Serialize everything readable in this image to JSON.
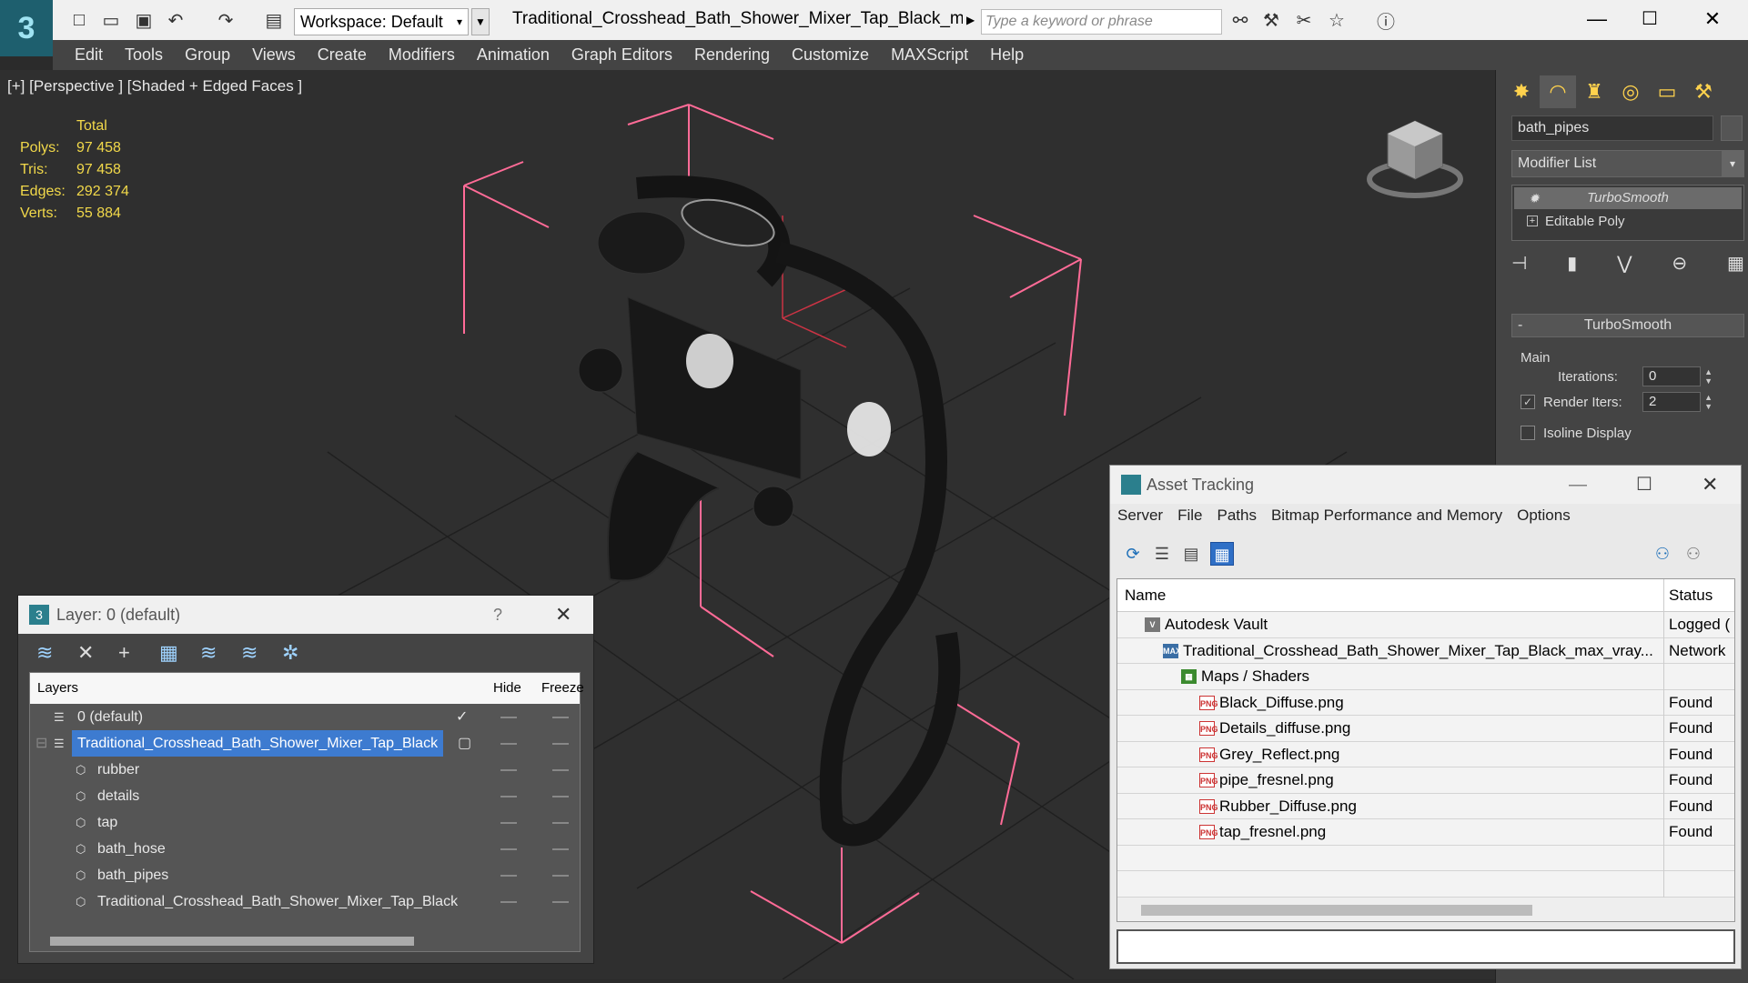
{
  "app": {
    "workspace": "Workspace: Default",
    "doc_title": "Traditional_Crosshead_Bath_Shower_Mixer_Tap_Black_max_v...",
    "search_placeholder": "Type a keyword or phrase"
  },
  "menu": [
    "Edit",
    "Tools",
    "Group",
    "Views",
    "Create",
    "Modifiers",
    "Animation",
    "Graph Editors",
    "Rendering",
    "Customize",
    "MAXScript",
    "Help"
  ],
  "viewport": {
    "label": "[+] [Perspective ] [Shaded + Edged Faces ]",
    "stats": {
      "header": "Total",
      "rows": [
        {
          "k": "Polys:",
          "v": "97 458"
        },
        {
          "k": "Tris:",
          "v": "97 458"
        },
        {
          "k": "Edges:",
          "v": "292 374"
        },
        {
          "k": "Verts:",
          "v": "55 884"
        }
      ]
    }
  },
  "command_panel": {
    "object_name": "bath_pipes",
    "modifier_list": "Modifier List",
    "stack": [
      "TurboSmooth",
      "Editable Poly"
    ],
    "rollout_title": "TurboSmooth",
    "main_label": "Main",
    "iterations_label": "Iterations:",
    "iterations_value": "0",
    "render_iters_label": "Render Iters:",
    "render_iters_value": "2",
    "isoline_label": "Isoline Display"
  },
  "layer_dialog": {
    "title": "Layer: 0 (default)",
    "help": "?",
    "columns": {
      "layers": "Layers",
      "hide": "Hide",
      "freeze": "Freeze"
    },
    "rows": [
      {
        "name": "0 (default)",
        "level": 0
      },
      {
        "name": "Traditional_Crosshead_Bath_Shower_Mixer_Tap_Black",
        "level": 0
      },
      {
        "name": "rubber",
        "level": 1
      },
      {
        "name": "details",
        "level": 1
      },
      {
        "name": "tap",
        "level": 1
      },
      {
        "name": "bath_hose",
        "level": 1
      },
      {
        "name": "bath_pipes",
        "level": 1
      },
      {
        "name": "Traditional_Crosshead_Bath_Shower_Mixer_Tap_Black",
        "level": 1
      }
    ]
  },
  "asset_dialog": {
    "title": "Asset Tracking",
    "menu": [
      "Server",
      "File",
      "Paths",
      "Bitmap Performance and Memory",
      "Options"
    ],
    "columns": {
      "name": "Name",
      "status": "Status"
    },
    "rows": [
      {
        "name": "Autodesk Vault",
        "status": "Logged (",
        "indent": 1,
        "icon": "vault"
      },
      {
        "name": "Traditional_Crosshead_Bath_Shower_Mixer_Tap_Black_max_vray...",
        "status": "Network",
        "indent": 2,
        "icon": "max"
      },
      {
        "name": "Maps / Shaders",
        "status": "",
        "indent": 3,
        "icon": "folder"
      },
      {
        "name": "Black_Diffuse.png",
        "status": "Found",
        "indent": 4,
        "icon": "png"
      },
      {
        "name": "Details_diffuse.png",
        "status": "Found",
        "indent": 4,
        "icon": "png"
      },
      {
        "name": "Grey_Reflect.png",
        "status": "Found",
        "indent": 4,
        "icon": "png"
      },
      {
        "name": "pipe_fresnel.png",
        "status": "Found",
        "indent": 4,
        "icon": "png"
      },
      {
        "name": "Rubber_Diffuse.png",
        "status": "Found",
        "indent": 4,
        "icon": "png"
      },
      {
        "name": "tap_fresnel.png",
        "status": "Found",
        "indent": 4,
        "icon": "png"
      }
    ]
  },
  "colors": {
    "stats": "#f2d94a",
    "selection": "#3d7bd0",
    "bbox": "#ff5f8a",
    "brand": "#1e5f6e"
  }
}
